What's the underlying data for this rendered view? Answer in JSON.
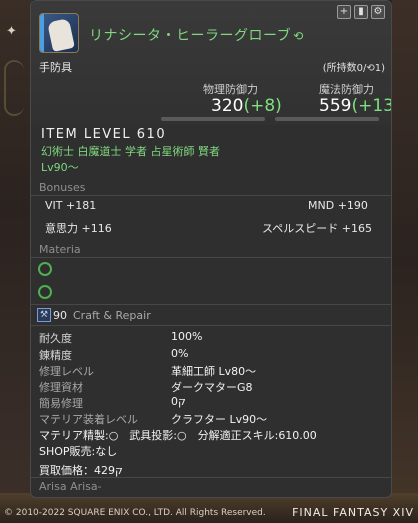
{
  "item": {
    "name": "リナシータ・ヒーラーグローブ",
    "hq_icon": "hq-icon",
    "category": "手防具",
    "owned": "(所持数0/",
    "owned_hq": "1)",
    "physical_defense_label": "物理防御力",
    "physical_defense_value": "320",
    "physical_defense_bonus": "(+8)",
    "magic_defense_label": "魔法防御力",
    "magic_defense_value": "559",
    "magic_defense_bonus": "(+13)",
    "item_level": "ITEM LEVEL 610",
    "jobs": "幻術士 白魔道士 学者 占星術師 賢者",
    "level": "Lv90～"
  },
  "top_buttons": [
    "+",
    "▮",
    "⚙"
  ],
  "bonuses": {
    "title": "Bonuses",
    "stats": [
      {
        "name": "VIT",
        "value": "+181"
      },
      {
        "name": "MND",
        "value": "+190"
      },
      {
        "name": "意思力",
        "value": "+116"
      },
      {
        "name": "スペルスピード",
        "value": "+165"
      }
    ]
  },
  "materia": {
    "title": "Materia",
    "slots": 2
  },
  "craft": {
    "level": "90",
    "title": "Craft & Repair",
    "rows": [
      {
        "label": "耐久度",
        "value": "100%"
      },
      {
        "label": "錬精度",
        "value": "0%"
      },
      {
        "label": "修理レベル",
        "value": "革細工師 Lv80～"
      },
      {
        "label": "修理資材",
        "value": "ダークマターG8"
      },
      {
        "label": "簡易修理",
        "value": "0ק"
      },
      {
        "label": "マテリア装着レベル",
        "value": "クラフター Lv90～"
      }
    ],
    "line1": "マテリア精製:○　武具投影:○　分解適正スキル:610.00",
    "line2": "SHOP販売:なし",
    "line3": "買取価格：429ק"
  },
  "arisa": "Arisa Arisa-",
  "footer": {
    "copyright": "© 2010-2022 SQUARE ENIX CO., LTD. All Rights Reserved.",
    "logo": "FINAL FANTASY XIV"
  }
}
